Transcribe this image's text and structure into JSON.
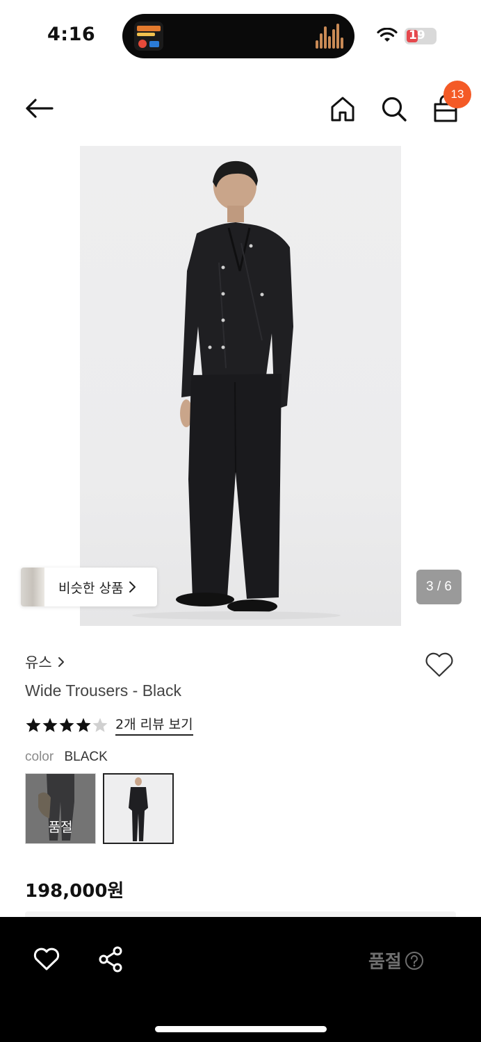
{
  "status_bar": {
    "time": "4:16",
    "battery": "19",
    "colors": {
      "battery_low": "#e5484d"
    }
  },
  "nav": {
    "back_icon": "arrow-left-icon",
    "home_icon": "home-icon",
    "search_icon": "search-icon",
    "bag_icon": "shopping-bag-icon",
    "cart_count": "13",
    "colors": {
      "badge": "#f45a26"
    }
  },
  "gallery": {
    "similar_label": "비슷한 상품",
    "page_indicator": "3 / 6",
    "current_page": 3,
    "total_pages": 6
  },
  "product": {
    "brand": "유스",
    "name": "Wide Trousers - Black",
    "rating": 4.5,
    "review_link": "2개 리뷰 보기",
    "color_label": "color",
    "color_value": "BLACK",
    "swatches": [
      {
        "state": "sold-out",
        "badge": "품절",
        "selected": false
      },
      {
        "state": "available",
        "selected": true
      }
    ],
    "price": "198,000원"
  },
  "bottom_bar": {
    "heart_icon": "heart-icon",
    "share_icon": "share-icon",
    "cta_label": "품절",
    "help_icon": "question-circle-icon"
  }
}
